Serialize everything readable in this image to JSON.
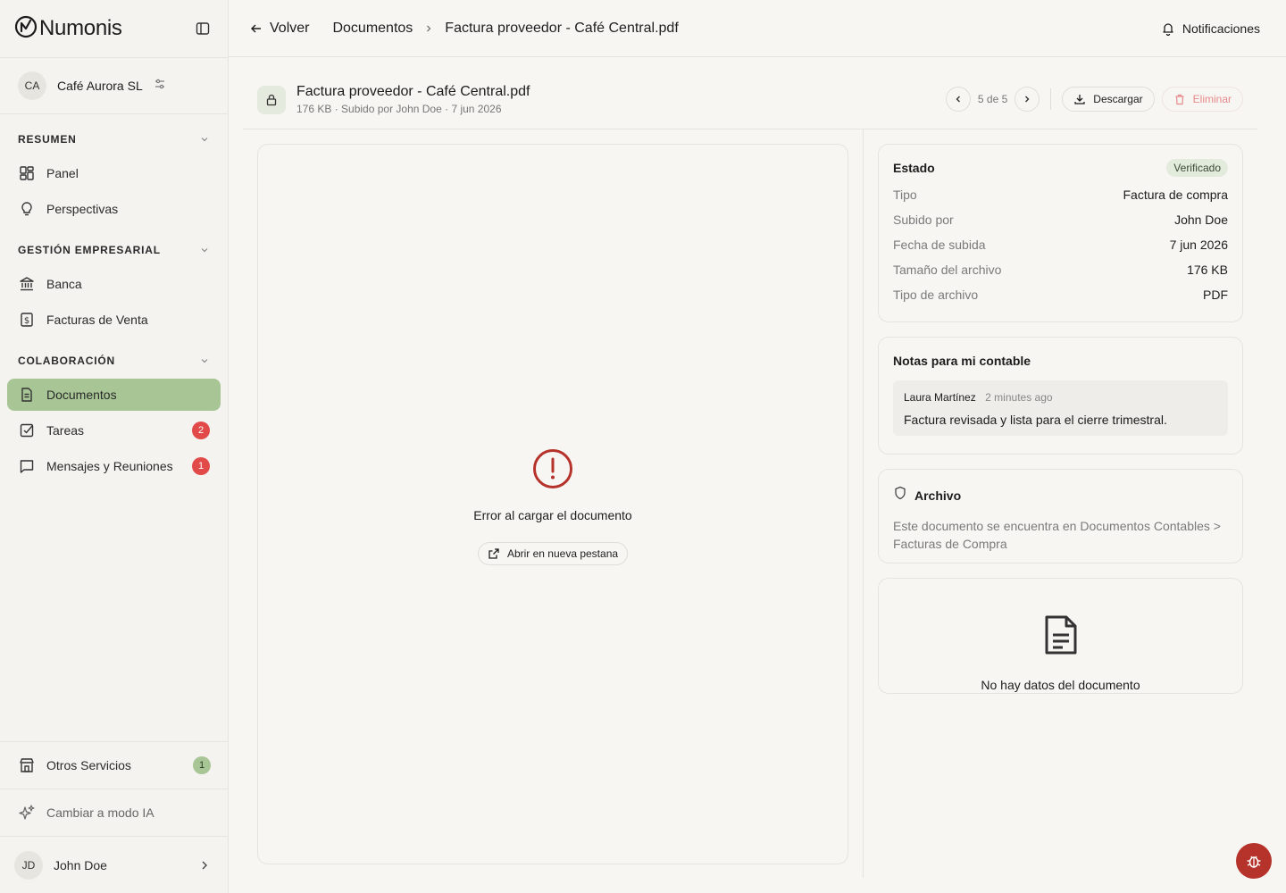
{
  "app": {
    "brand": "Numonis"
  },
  "company": {
    "initials": "CA",
    "name": "Café Aurora SL"
  },
  "sidebar": {
    "sections": [
      {
        "title": "RESUMEN",
        "items": [
          {
            "label": "Panel",
            "icon": "dashboard-icon"
          },
          {
            "label": "Perspectivas",
            "icon": "lightbulb-icon"
          }
        ]
      },
      {
        "title": "GESTIÓN EMPRESARIAL",
        "items": [
          {
            "label": "Banca",
            "icon": "bank-icon"
          },
          {
            "label": "Facturas de Venta",
            "icon": "dollar-receipt-icon"
          }
        ]
      },
      {
        "title": "COLABORACIÓN",
        "items": [
          {
            "label": "Documentos",
            "icon": "document-icon",
            "active": true
          },
          {
            "label": "Tareas",
            "icon": "checkbox-icon",
            "badge": "2"
          },
          {
            "label": "Mensajes y Reuniones",
            "icon": "chat-icon",
            "badge": "1"
          }
        ]
      }
    ],
    "bottom": {
      "services_label": "Otros Servicios",
      "services_badge": "1",
      "ai_mode_label": "Cambiar a modo IA",
      "user_initials": "JD",
      "user_name": "John Doe"
    }
  },
  "topbar": {
    "back_label": "Volver",
    "breadcrumb_root": "Documentos",
    "breadcrumb_current": "Factura proveedor - Café Central.pdf",
    "notifications_label": "Notificaciones"
  },
  "document": {
    "title": "Factura proveedor - Café Central.pdf",
    "meta": "176 KB · Subido por John Doe · 7 jun 2026",
    "pager": "5 de 5",
    "download_label": "Descargar",
    "delete_label": "Eliminar"
  },
  "viewer": {
    "error_text": "Error al cargar el documento",
    "open_new_tab_label": "Abrir en nueva pestana"
  },
  "estado": {
    "title": "Estado",
    "status": "Verificado",
    "rows": [
      {
        "k": "Tipo",
        "v": "Factura de compra"
      },
      {
        "k": "Subido por",
        "v": "John Doe"
      },
      {
        "k": "Fecha de subida",
        "v": "7 jun 2026"
      },
      {
        "k": "Tamaño del archivo",
        "v": "176 KB"
      },
      {
        "k": "Tipo de archivo",
        "v": "PDF"
      }
    ]
  },
  "notes": {
    "title": "Notas para mi contable",
    "author": "Laura Martínez",
    "time": "2 minutes ago",
    "text": "Factura revisada y lista para el cierre trimestral."
  },
  "archive": {
    "title": "Archivo",
    "text": "Este documento se encuentra en Documentos Contables > Facturas de Compra"
  },
  "no_data": {
    "text": "No hay datos del documento"
  },
  "colors": {
    "accent": "#a8c595",
    "badge_red": "#e24a4a",
    "bug_button": "#b6332b"
  }
}
